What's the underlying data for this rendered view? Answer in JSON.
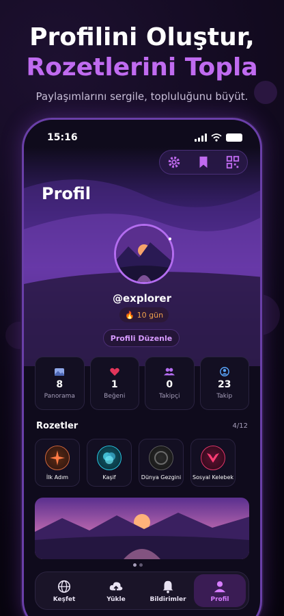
{
  "promo": {
    "title_line1": "Profilini Oluştur,",
    "title_line2": "Rozetlerini Topla",
    "subtitle": "Paylaşımlarını sergile, topluluğunu büyüt."
  },
  "status_bar": {
    "time": "15:16"
  },
  "toolbar": {
    "icons": [
      "settings-icon",
      "bookmark-icon",
      "qr-code-icon"
    ]
  },
  "profile": {
    "page_title": "Profil",
    "username": "@explorer",
    "streak_emoji": "🔥",
    "streak": "10 gün",
    "edit_label": "Profili Düzenle"
  },
  "stats": [
    {
      "icon": "image-icon",
      "value": "8",
      "label": "Panorama"
    },
    {
      "icon": "heart-icon",
      "value": "1",
      "label": "Beğeni"
    },
    {
      "icon": "users-icon",
      "value": "0",
      "label": "Takipçi"
    },
    {
      "icon": "user-check-icon",
      "value": "23",
      "label": "Takip"
    }
  ],
  "badges_section": {
    "title": "Rozetler",
    "count": "4/12"
  },
  "badges": [
    {
      "label": "İlk Adım",
      "icon": "starburst-icon"
    },
    {
      "label": "Kaşif",
      "icon": "circles-icon"
    },
    {
      "label": "Dünya Gezgini",
      "icon": "globe-ring-icon"
    },
    {
      "label": "Sosyal Kelebek",
      "icon": "butterfly-icon"
    }
  ],
  "tabs": [
    {
      "label": "Keşfet",
      "icon": "globe-icon",
      "active": false
    },
    {
      "label": "Yükle",
      "icon": "cloud-upload-icon",
      "active": false
    },
    {
      "label": "Bildirimler",
      "icon": "bell-icon",
      "active": false
    },
    {
      "label": "Profil",
      "icon": "person-icon",
      "active": true
    }
  ],
  "colors": {
    "accent": "#c06bf0",
    "active_tab": "#d77dff",
    "streak": "#f2a24c"
  }
}
